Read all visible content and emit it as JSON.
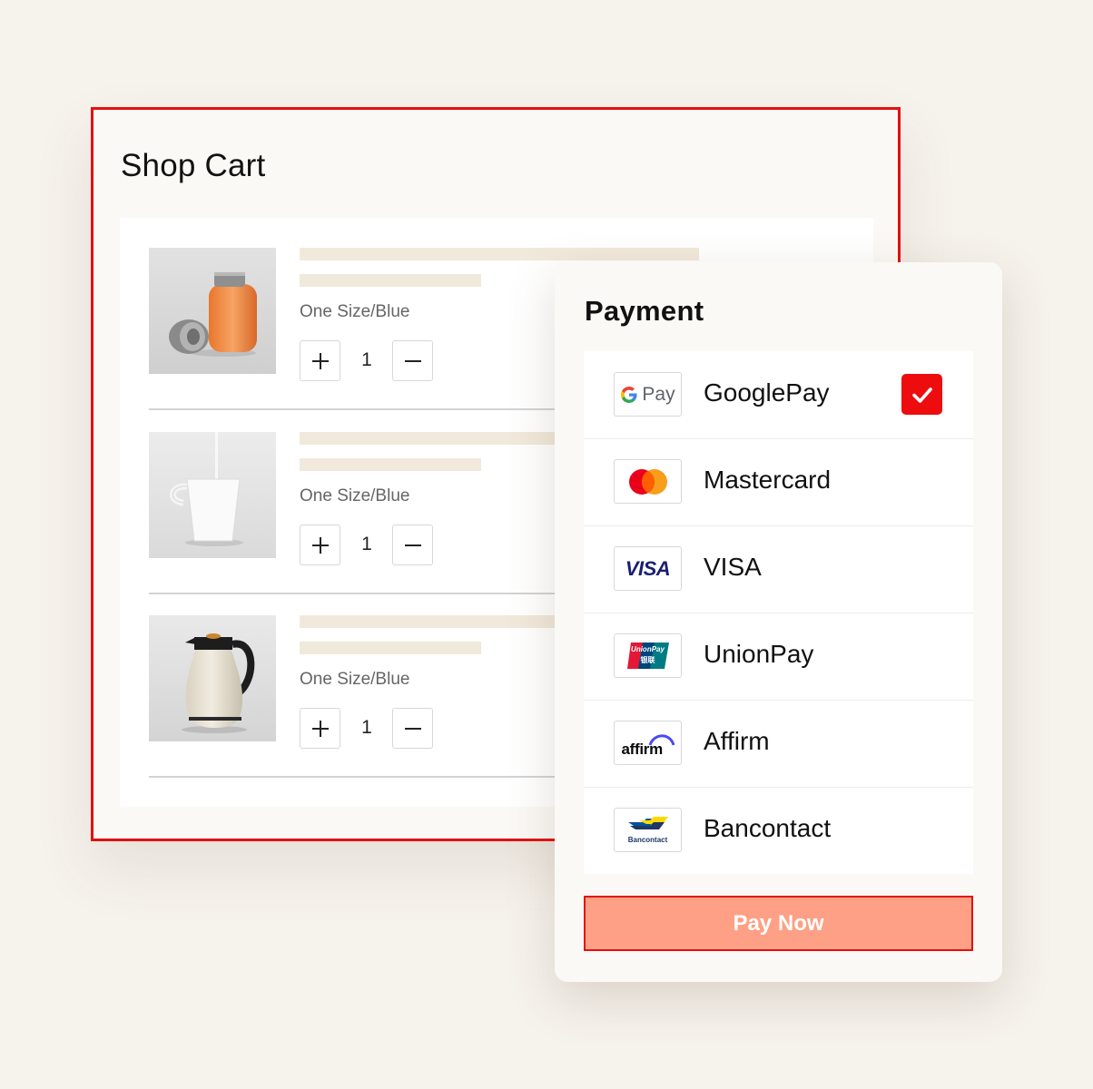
{
  "cart": {
    "title": "Shop Cart",
    "items": [
      {
        "variant": "One Size/Blue",
        "quantity": "1",
        "image": "orange-thermos-bottle"
      },
      {
        "variant": "One Size/Blue",
        "quantity": "1",
        "image": "white-mug-pouring-milk"
      },
      {
        "variant": "One Size/Blue",
        "quantity": "1",
        "image": "cream-vacuum-jug"
      }
    ]
  },
  "payment": {
    "title": "Payment",
    "methods": [
      {
        "name": "GooglePay",
        "logo": "google-pay-logo",
        "selected": true
      },
      {
        "name": "Mastercard",
        "logo": "mastercard-logo",
        "selected": false
      },
      {
        "name": "VISA",
        "logo": "visa-logo",
        "selected": false
      },
      {
        "name": "UnionPay",
        "logo": "unionpay-logo",
        "selected": false
      },
      {
        "name": "Affirm",
        "logo": "affirm-logo",
        "selected": false
      },
      {
        "name": "Bancontact",
        "logo": "bancontact-logo",
        "selected": false
      }
    ],
    "logo_text": {
      "gpay": "Pay",
      "visa": "VISA",
      "unionpay_top": "UnionPay",
      "unionpay_bottom": "银联",
      "affirm": "affirm",
      "bancontact": "Bancontact"
    },
    "pay_button": "Pay Now"
  },
  "colors": {
    "accent_red": "#e4100f",
    "pay_button_fill": "#fea085",
    "placeholder_bar": "#f1e9db",
    "background": "#f6f2ec"
  }
}
